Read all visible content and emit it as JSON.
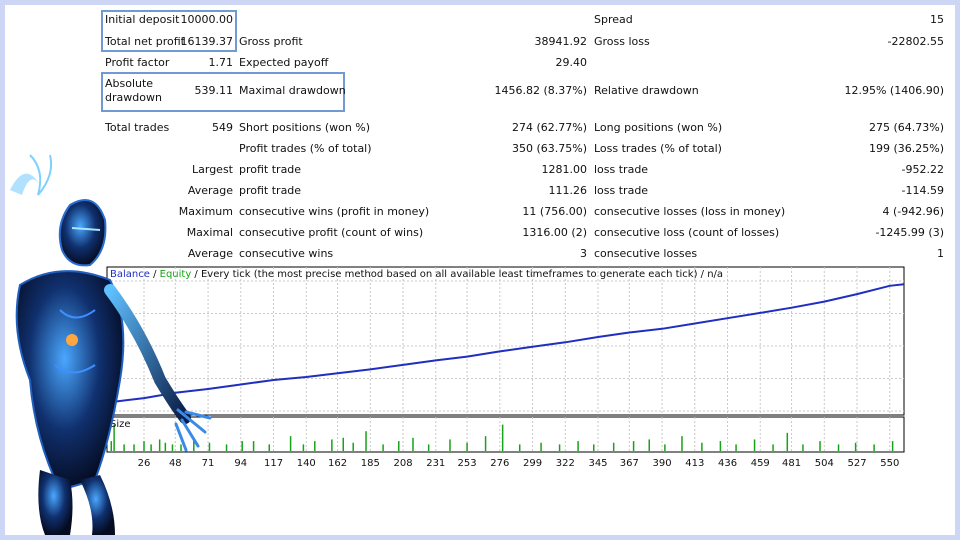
{
  "report": {
    "initial_deposit": {
      "label": "Initial deposit",
      "value": "10000.00"
    },
    "spread": {
      "label": "Spread",
      "value": "15"
    },
    "total_net_profit": {
      "label": "Total net profit",
      "value": "16139.37"
    },
    "gross_profit": {
      "label": "Gross profit",
      "value": "38941.92"
    },
    "gross_loss": {
      "label": "Gross loss",
      "value": "-22802.55"
    },
    "profit_factor": {
      "label": "Profit factor",
      "value": "1.71"
    },
    "expected_payoff": {
      "label": "Expected payoff",
      "value": "29.40"
    },
    "absolute_drawdown": {
      "label_line1": "Absolute",
      "label_line2": "drawdown",
      "value": "539.11"
    },
    "maximal_drawdown": {
      "label": "Maximal drawdown",
      "value": "1456.82 (8.37%)"
    },
    "relative_drawdown": {
      "label": "Relative drawdown",
      "value": "12.95% (1406.90)"
    },
    "total_trades": {
      "label": "Total trades",
      "value": "549"
    },
    "short_positions": {
      "label": "Short positions (won %)",
      "value": "274 (62.77%)"
    },
    "long_positions": {
      "label": "Long positions (won %)",
      "value": "275 (64.73%)"
    },
    "profit_trades": {
      "label": "Profit trades (% of total)",
      "value": "350 (63.75%)"
    },
    "loss_trades": {
      "label": "Loss trades (% of total)",
      "value": "199 (36.25%)"
    },
    "largest": {
      "label": "Largest",
      "profit_label": "profit trade",
      "profit_value": "1281.00",
      "loss_label": "loss trade",
      "loss_value": "-952.22"
    },
    "average": {
      "label": "Average",
      "profit_label": "profit trade",
      "profit_value": "111.26",
      "loss_label": "loss trade",
      "loss_value": "-114.59"
    },
    "maximum": {
      "label": "Maximum",
      "wins_label": "consecutive wins (profit in money)",
      "wins_value": "11 (756.00)",
      "losses_label": "consecutive losses (loss in money)",
      "losses_value": "4 (-942.96)"
    },
    "maximal": {
      "label": "Maximal",
      "profit_label": "consecutive profit (count of wins)",
      "profit_value": "1316.00 (2)",
      "loss_label": "consecutive loss (count of losses)",
      "loss_value": "-1245.99 (3)"
    },
    "average_consecutive": {
      "label": "Average",
      "wins_label": "consecutive wins",
      "wins_value": "3",
      "losses_label": "consecutive losses",
      "losses_value": "1"
    }
  },
  "chart_legend": {
    "balance": "Balance",
    "sep1": " / ",
    "equity": "Equity",
    "rest": " / Every tick (the most precise method based on all available least timeframes to generate each tick) / n/a"
  },
  "chart_data": {
    "type": "line",
    "title": "",
    "xlabel": "",
    "ylabel": "",
    "x_ticks": [
      26,
      48,
      71,
      94,
      117,
      140,
      162,
      185,
      208,
      231,
      253,
      276,
      299,
      322,
      345,
      367,
      390,
      413,
      436,
      459,
      481,
      504,
      527,
      550
    ],
    "y_ticks": [
      26040,
      21725,
      17410,
      13096,
      8781
    ],
    "xlim": [
      0,
      560
    ],
    "ylim": [
      8781,
      26040
    ],
    "size_label": "Size",
    "colors": {
      "balance": "#1f2fbf",
      "equity": "#17a317",
      "grid": "#c8c8c8"
    },
    "series": [
      {
        "name": "Balance",
        "x": [
          0,
          26,
          48,
          71,
          94,
          117,
          140,
          162,
          185,
          208,
          231,
          253,
          276,
          299,
          322,
          345,
          367,
          390,
          413,
          436,
          459,
          481,
          504,
          527,
          550,
          560
        ],
        "y": [
          9900,
          10500,
          11200,
          11700,
          12300,
          12900,
          13300,
          13800,
          14300,
          14900,
          15500,
          16000,
          16700,
          17300,
          17900,
          18600,
          19200,
          19700,
          20400,
          21100,
          21800,
          22500,
          23300,
          24300,
          25400,
          25600
        ]
      }
    ],
    "size_bars": {
      "x": [
        3,
        5,
        12,
        19,
        26,
        31,
        37,
        41,
        46,
        52,
        61,
        72,
        84,
        95,
        103,
        114,
        129,
        138,
        146,
        158,
        166,
        173,
        182,
        194,
        205,
        215,
        226,
        241,
        253,
        266,
        278,
        290,
        305,
        318,
        331,
        342,
        356,
        370,
        381,
        392,
        404,
        418,
        431,
        442,
        455,
        468,
        478,
        489,
        501,
        514,
        526,
        539,
        552
      ],
      "y": [
        0.3,
        0.8,
        0.2,
        0.2,
        0.3,
        0.2,
        0.35,
        0.25,
        0.2,
        0.2,
        0.4,
        0.25,
        0.2,
        0.3,
        0.3,
        0.2,
        0.45,
        0.2,
        0.3,
        0.35,
        0.4,
        0.25,
        0.6,
        0.2,
        0.3,
        0.4,
        0.2,
        0.35,
        0.25,
        0.45,
        0.8,
        0.2,
        0.25,
        0.2,
        0.3,
        0.2,
        0.25,
        0.3,
        0.35,
        0.2,
        0.45,
        0.25,
        0.3,
        0.2,
        0.35,
        0.2,
        0.55,
        0.2,
        0.3,
        0.2,
        0.25,
        0.2,
        0.3
      ]
    }
  }
}
